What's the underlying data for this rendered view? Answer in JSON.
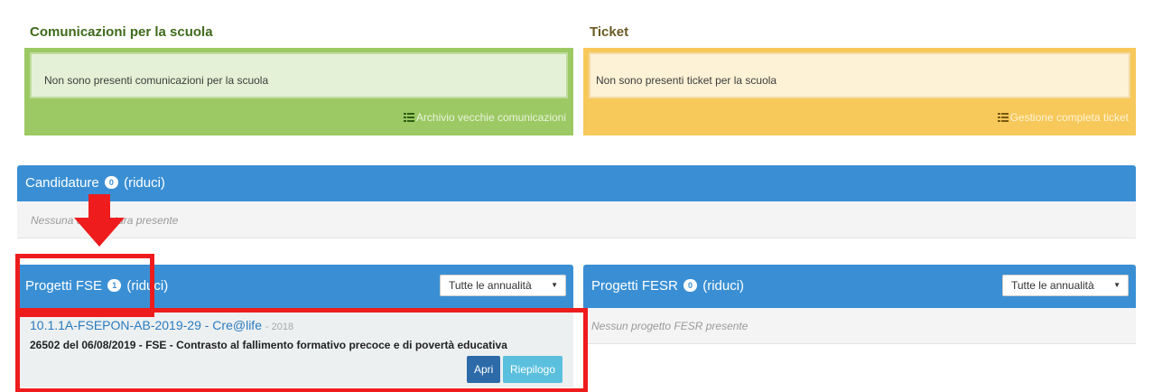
{
  "comunicazioni": {
    "title": "Comunicazioni per la scuola",
    "message": "Non sono presenti comunicazioni per la scuola",
    "archive_link": "Archivio vecchie comunicazioni"
  },
  "ticket": {
    "title": "Ticket",
    "message": "Non sono presenti ticket per la scuola",
    "manage_link": "Gestione completa ticket"
  },
  "candidature": {
    "title": "Candidature",
    "count": "0",
    "toggle": "(riduci)",
    "empty": "Nessuna candidatura presente"
  },
  "progetti_fse": {
    "title": "Progetti FSE",
    "count": "1",
    "toggle": "(riduci)",
    "filter": "Tutte le annualità",
    "project": {
      "code_title": "10.1.1A-FSEPON-AB-2019-29 - Cre@life",
      "year": "- 2018",
      "description": "26502 del 06/08/2019 - FSE - Contrasto al fallimento formativo precoce e di povertà educativa",
      "btn_open": "Apri",
      "btn_summary": "Riepilogo"
    }
  },
  "progetti_fesr": {
    "title": "Progetti FESR",
    "count": "0",
    "toggle": "(riduci)",
    "filter": "Tutte le annualità",
    "empty": "Nessun progetto FESR presente"
  },
  "colors": {
    "green_panel": "#9cc964",
    "yellow_panel": "#f7c85a",
    "blue_header": "#3a8fd4",
    "annotation_red": "#ee1c1c"
  },
  "icons": [
    "list-icon",
    "caret-down-icon",
    "arrow-down-icon"
  ]
}
